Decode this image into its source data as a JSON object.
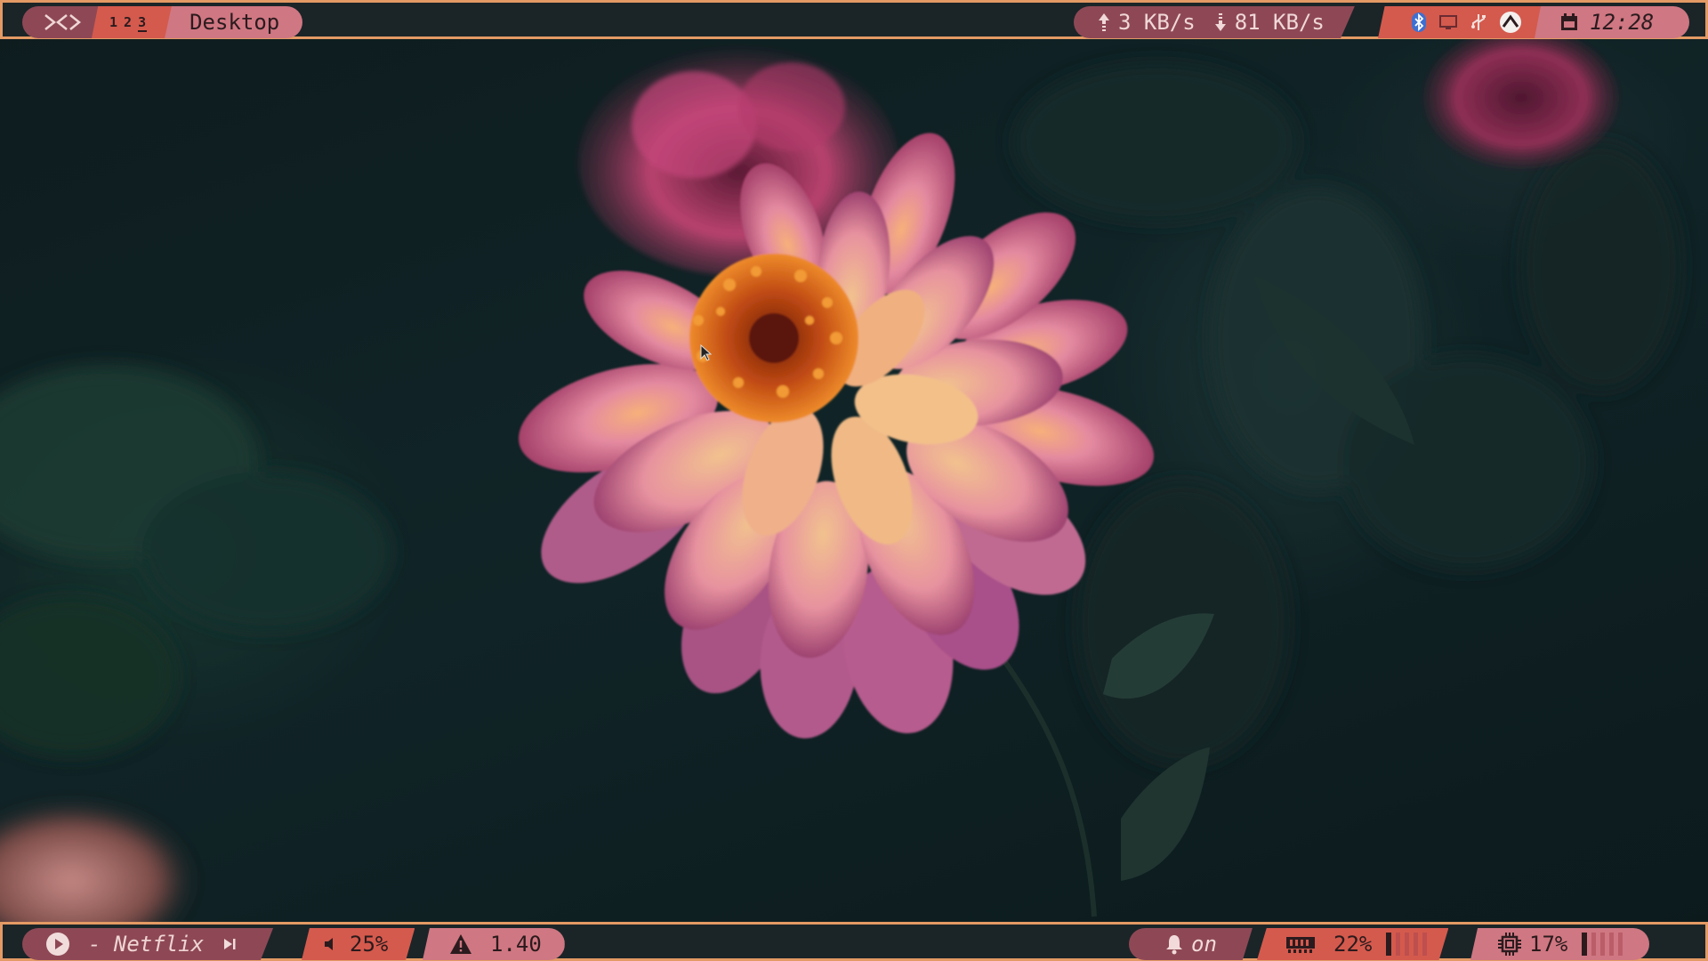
{
  "top_bar": {
    "launcher_icon": "code-brackets-icon",
    "workspaces": "1 2 3",
    "active_workspace_underline": "3",
    "window_title": "Desktop",
    "net_up": "3 KB/s",
    "net_down": "81 KB/s",
    "tray_icons": [
      "bluetooth-icon",
      "display-icon",
      "usb-icon",
      "vpn-icon"
    ],
    "clock": "12:28"
  },
  "bottom_bar": {
    "media_state_icon": "play-icon",
    "media_title": "- Netflix",
    "next_icon": "skip-next-icon",
    "volume": "25%",
    "load_average": "1.40",
    "notifications": "on",
    "memory": "22%",
    "memory_level": 0.22,
    "cpu": "17%",
    "cpu_level": 0.17
  },
  "colors": {
    "border": "#e39a64",
    "bar_bg": "#1b2528",
    "seg_dark": "#8e4855",
    "seg_red": "#d45a4d",
    "seg_pink": "#cf7782"
  }
}
